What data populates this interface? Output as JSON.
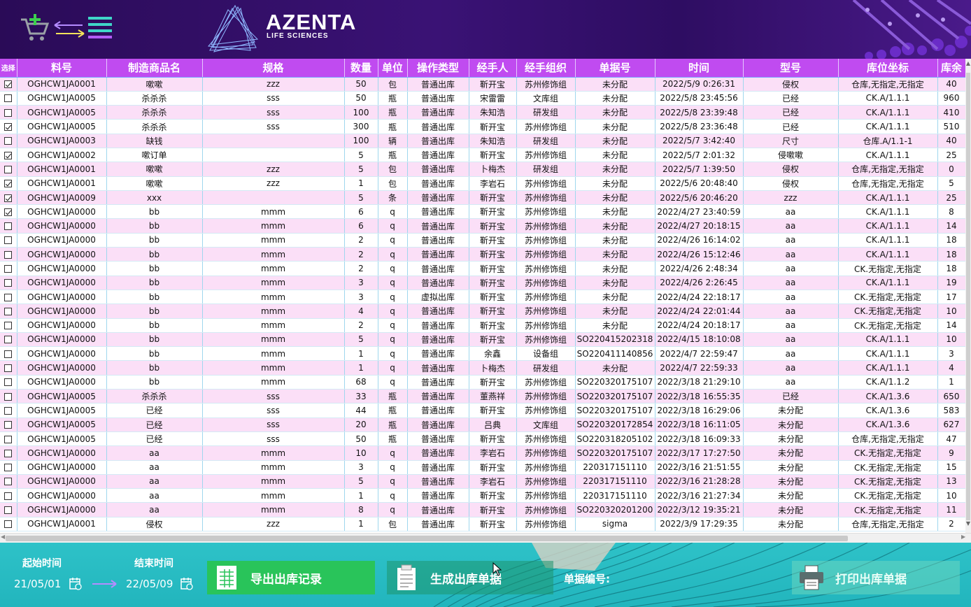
{
  "header": {
    "logo_text": "AZENTA",
    "logo_sub": "LIFE SCIENCES"
  },
  "table": {
    "columns": [
      "选择",
      "料号",
      "制造商品名",
      "规格",
      "数量",
      "单位",
      "操作类型",
      "经手人",
      "经手组织",
      "单据号",
      "时间",
      "型号",
      "库位坐标",
      "库余"
    ],
    "rows": [
      [
        true,
        "OGHCW1JA0001",
        "嗽嗽",
        "zzz",
        "50",
        "包",
        "普通出库",
        "靳开宝",
        "苏州修饰组",
        "未分配",
        "2022/5/9 0:26:31",
        "侵权",
        "仓库,无指定,无指定",
        "40"
      ],
      [
        false,
        "OGHCW1JA0005",
        "杀杀杀",
        "sss",
        "50",
        "瓶",
        "普通出库",
        "宋雷雷",
        "文库组",
        "未分配",
        "2022/5/8 23:45:56",
        "已经",
        "CK.A/1.1.1",
        "960"
      ],
      [
        false,
        "OGHCW1JA0005",
        "杀杀杀",
        "sss",
        "100",
        "瓶",
        "普通出库",
        "朱知浩",
        "研发组",
        "未分配",
        "2022/5/8 23:39:48",
        "已经",
        "CK.A/1.1.1",
        "410"
      ],
      [
        true,
        "OGHCW1JA0005",
        "杀杀杀",
        "sss",
        "300",
        "瓶",
        "普通出库",
        "靳开宝",
        "苏州修饰组",
        "未分配",
        "2022/5/8 23:36:48",
        "已经",
        "CK.A/1.1.1",
        "510"
      ],
      [
        false,
        "OGHCW1JA0003",
        "缺钱",
        "",
        "100",
        "辆",
        "普通出库",
        "朱知浩",
        "研发组",
        "未分配",
        "2022/5/7 3:42:40",
        "尺寸",
        "仓库.A/1.1-1",
        "40"
      ],
      [
        true,
        "OGHCW1JA0002",
        "嗽订单",
        "",
        "5",
        "瓶",
        "普通出库",
        "靳开宝",
        "苏州修饰组",
        "未分配",
        "2022/5/7 2:01:32",
        "侵嗽嗽",
        "CK.A/1.1.1",
        "25"
      ],
      [
        false,
        "OGHCW1JA0001",
        "嗽嗽",
        "zzz",
        "5",
        "包",
        "普通出库",
        "卜梅杰",
        "研发组",
        "未分配",
        "2022/5/7 1:39:50",
        "侵权",
        "仓库,无指定,无指定",
        "0"
      ],
      [
        true,
        "OGHCW1JA0001",
        "嗽嗽",
        "zzz",
        "1",
        "包",
        "普通出库",
        "李岩石",
        "苏州修饰组",
        "未分配",
        "2022/5/6 20:48:40",
        "侵权",
        "仓库,无指定,无指定",
        "5"
      ],
      [
        true,
        "OGHCW1JA0009",
        "xxx",
        "",
        "5",
        "条",
        "普通出库",
        "靳开宝",
        "苏州修饰组",
        "未分配",
        "2022/5/6 20:46:20",
        "zzz",
        "CK.A/1.1.1",
        "25"
      ],
      [
        true,
        "OGHCW1JA0000",
        "bb",
        "mmm",
        "6",
        "q",
        "普通出库",
        "靳开宝",
        "苏州修饰组",
        "未分配",
        "2022/4/27 23:40:59",
        "aa",
        "CK.A/1.1.1",
        "8"
      ],
      [
        false,
        "OGHCW1JA0000",
        "bb",
        "mmm",
        "6",
        "q",
        "普通出库",
        "靳开宝",
        "苏州修饰组",
        "未分配",
        "2022/4/27 20:18:15",
        "aa",
        "CK.A/1.1.1",
        "14"
      ],
      [
        false,
        "OGHCW1JA0000",
        "bb",
        "mmm",
        "2",
        "q",
        "普通出库",
        "靳开宝",
        "苏州修饰组",
        "未分配",
        "2022/4/26 16:14:02",
        "aa",
        "CK.A/1.1.1",
        "18"
      ],
      [
        false,
        "OGHCW1JA0000",
        "bb",
        "mmm",
        "2",
        "q",
        "普通出库",
        "靳开宝",
        "苏州修饰组",
        "未分配",
        "2022/4/26 15:12:46",
        "aa",
        "CK.A/1.1.1",
        "18"
      ],
      [
        false,
        "OGHCW1JA0000",
        "bb",
        "mmm",
        "2",
        "q",
        "普通出库",
        "靳开宝",
        "苏州修饰组",
        "未分配",
        "2022/4/26 2:48:34",
        "aa",
        "CK.无指定,无指定",
        "18"
      ],
      [
        false,
        "OGHCW1JA0000",
        "bb",
        "mmm",
        "3",
        "q",
        "普通出库",
        "靳开宝",
        "苏州修饰组",
        "未分配",
        "2022/4/26 2:26:45",
        "aa",
        "CK.A/1.1.1",
        "19"
      ],
      [
        false,
        "OGHCW1JA0000",
        "bb",
        "mmm",
        "3",
        "q",
        "虚拟出库",
        "靳开宝",
        "苏州修饰组",
        "未分配",
        "2022/4/24 22:18:17",
        "aa",
        "CK.无指定,无指定",
        "17"
      ],
      [
        false,
        "OGHCW1JA0000",
        "bb",
        "mmm",
        "4",
        "q",
        "普通出库",
        "靳开宝",
        "苏州修饰组",
        "未分配",
        "2022/4/24 22:01:44",
        "aa",
        "CK.无指定,无指定",
        "10"
      ],
      [
        false,
        "OGHCW1JA0000",
        "bb",
        "mmm",
        "2",
        "q",
        "普通出库",
        "靳开宝",
        "苏州修饰组",
        "未分配",
        "2022/4/24 20:18:17",
        "aa",
        "CK.无指定,无指定",
        "14"
      ],
      [
        false,
        "OGHCW1JA0000",
        "bb",
        "mmm",
        "5",
        "q",
        "普通出库",
        "靳开宝",
        "苏州修饰组",
        "SO220415202318",
        "2022/4/15 18:10:08",
        "aa",
        "CK.A/1.1.1",
        "10"
      ],
      [
        false,
        "OGHCW1JA0000",
        "bb",
        "mmm",
        "1",
        "q",
        "普通出库",
        "余鑫",
        "设备组",
        "SO220411140856",
        "2022/4/7 22:59:47",
        "aa",
        "CK.A/1.1.1",
        "3"
      ],
      [
        false,
        "OGHCW1JA0000",
        "bb",
        "mmm",
        "1",
        "q",
        "普通出库",
        "卜梅杰",
        "研发组",
        "未分配",
        "2022/4/7 22:59:33",
        "aa",
        "CK.A/1.1.1",
        "4"
      ],
      [
        false,
        "OGHCW1JA0000",
        "bb",
        "mmm",
        "68",
        "q",
        "普通出库",
        "靳开宝",
        "苏州修饰组",
        "SO220320175107",
        "2022/3/18 21:29:10",
        "aa",
        "CK.A/1.1.2",
        "1"
      ],
      [
        false,
        "OGHCW1JA0005",
        "杀杀杀",
        "sss",
        "33",
        "瓶",
        "普通出库",
        "董燕祥",
        "苏州修饰组",
        "SO220320175107",
        "2022/3/18 16:55:35",
        "已经",
        "CK.A/1.3.6",
        "650"
      ],
      [
        false,
        "OGHCW1JA0005",
        "已经",
        "sss",
        "44",
        "瓶",
        "普通出库",
        "靳开宝",
        "苏州修饰组",
        "SO220320175107",
        "2022/3/18 16:29:06",
        "未分配",
        "CK.A/1.3.6",
        "583"
      ],
      [
        false,
        "OGHCW1JA0005",
        "已经",
        "sss",
        "20",
        "瓶",
        "普通出库",
        "吕典",
        "文库组",
        "SO220320172854",
        "2022/3/18 16:11:05",
        "未分配",
        "CK.A/1.3.6",
        "627"
      ],
      [
        false,
        "OGHCW1JA0005",
        "已经",
        "sss",
        "50",
        "瓶",
        "普通出库",
        "靳开宝",
        "苏州修饰组",
        "SO220318205102",
        "2022/3/18 16:09:33",
        "未分配",
        "仓库,无指定,无指定",
        "47"
      ],
      [
        false,
        "OGHCW1JA0000",
        "aa",
        "mmm",
        "10",
        "q",
        "普通出库",
        "李岩石",
        "苏州修饰组",
        "SO220320175107",
        "2022/3/17 17:27:50",
        "未分配",
        "CK.无指定,无指定",
        "9"
      ],
      [
        false,
        "OGHCW1JA0000",
        "aa",
        "mmm",
        "3",
        "q",
        "普通出库",
        "靳开宝",
        "苏州修饰组",
        "220317151110",
        "2022/3/16 21:51:55",
        "未分配",
        "CK.无指定,无指定",
        "15"
      ],
      [
        false,
        "OGHCW1JA0000",
        "aa",
        "mmm",
        "5",
        "q",
        "普通出库",
        "李岩石",
        "苏州修饰组",
        "220317151110",
        "2022/3/16 21:28:28",
        "未分配",
        "CK.无指定,无指定",
        "13"
      ],
      [
        false,
        "OGHCW1JA0000",
        "aa",
        "mmm",
        "1",
        "q",
        "普通出库",
        "靳开宝",
        "苏州修饰组",
        "220317151110",
        "2022/3/16 21:27:34",
        "未分配",
        "CK.无指定,无指定",
        "10"
      ],
      [
        false,
        "OGHCW1JA0000",
        "aa",
        "mmm",
        "8",
        "q",
        "普通出库",
        "靳开宝",
        "苏州修饰组",
        "SO220320201200",
        "2022/3/12 19:35:21",
        "未分配",
        "CK.无指定,无指定",
        "11"
      ],
      [
        false,
        "OGHCW1JA0001",
        "侵权",
        "zzz",
        "1",
        "包",
        "普通出库",
        "靳开宝",
        "苏州修饰组",
        "sigma",
        "2022/3/9 17:29:35",
        "未分配",
        "仓库,无指定,无指定",
        "2"
      ]
    ]
  },
  "footer": {
    "start_label": "起始时间",
    "end_label": "结束时间",
    "start_date": "21/05/01",
    "end_date": "22/05/09",
    "export_label": "导出出库记录",
    "generate_label": "生成出库单据",
    "billno_label": "单据编号:",
    "print_label": "打印出库单据"
  },
  "colors": {
    "header_bg": "#2a0b57",
    "table_header": "#c04bf0",
    "row_alt": "#fbdff7",
    "footer_bg": "#2ec2c8",
    "export_button": "#29c45a"
  }
}
